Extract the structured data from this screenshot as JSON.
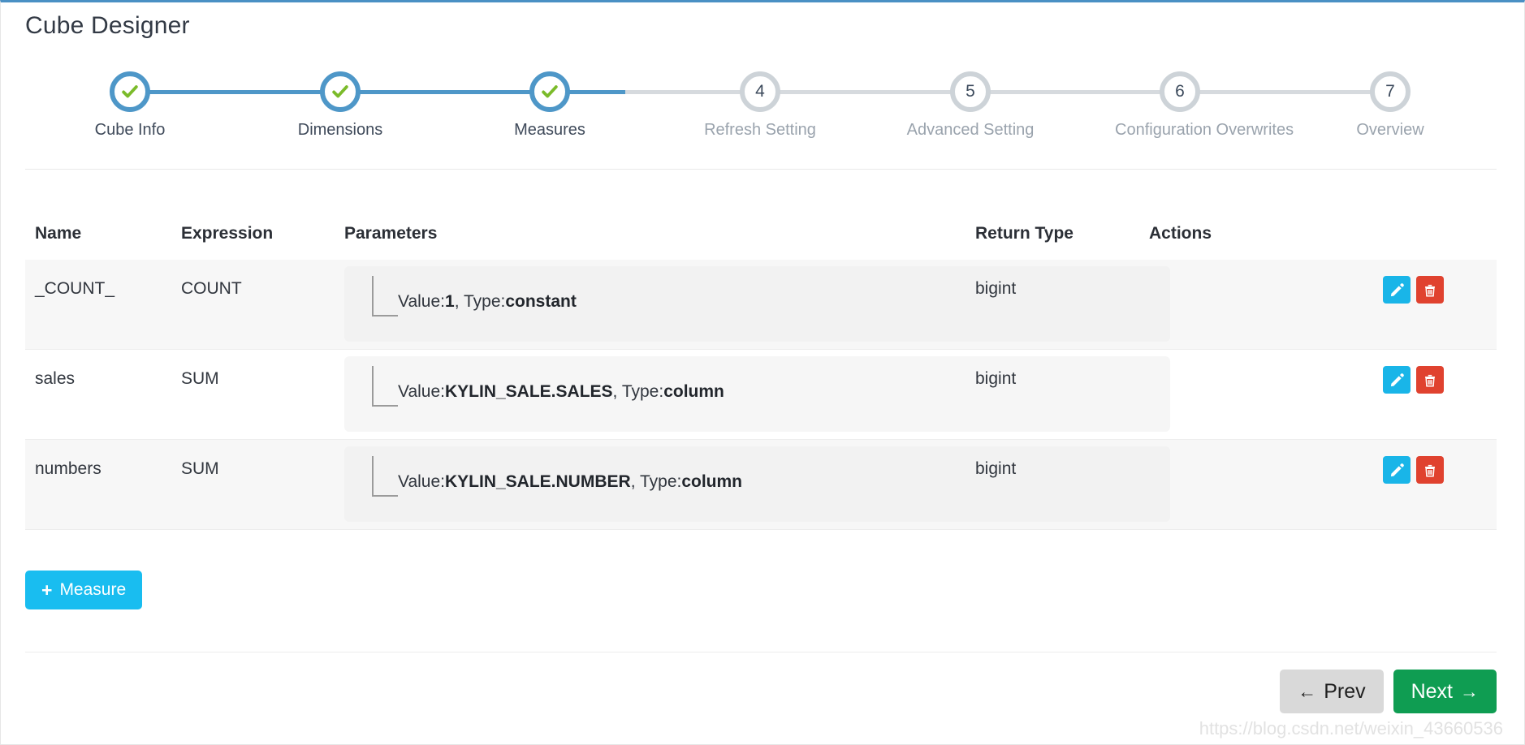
{
  "page": {
    "title": "Cube Designer",
    "accent_blue": "#4e97c8",
    "accent_green": "#0f9d52",
    "watermark": "https://blog.csdn.net/weixin_43660536"
  },
  "wizard": {
    "current_step": 3,
    "steps": [
      {
        "number": "1",
        "label": "Cube Info",
        "state": "done"
      },
      {
        "number": "2",
        "label": "Dimensions",
        "state": "done"
      },
      {
        "number": "3",
        "label": "Measures",
        "state": "done"
      },
      {
        "number": "4",
        "label": "Refresh Setting",
        "state": "todo"
      },
      {
        "number": "5",
        "label": "Advanced Setting",
        "state": "todo"
      },
      {
        "number": "6",
        "label": "Configuration Overwrites",
        "state": "todo"
      },
      {
        "number": "7",
        "label": "Overview",
        "state": "todo"
      }
    ]
  },
  "table": {
    "columns": {
      "name": "Name",
      "expression": "Expression",
      "parameters": "Parameters",
      "return_type": "Return Type",
      "actions": "Actions"
    },
    "rows": [
      {
        "name": "_COUNT_",
        "expression": "COUNT",
        "param_value_label": "Value:",
        "param_value": "1",
        "param_type_label": ", Type:",
        "param_type": "constant",
        "return_type": "bigint"
      },
      {
        "name": "sales",
        "expression": "SUM",
        "param_value_label": "Value:",
        "param_value": "KYLIN_SALE.SALES",
        "param_type_label": ", Type:",
        "param_type": "column",
        "return_type": "bigint"
      },
      {
        "name": "numbers",
        "expression": "SUM",
        "param_value_label": "Value:",
        "param_value": "KYLIN_SALE.NUMBER",
        "param_type_label": ", Type:",
        "param_type": "column",
        "return_type": "bigint"
      }
    ],
    "row_action_labels": {
      "edit": "Edit",
      "delete": "Delete"
    }
  },
  "add_measure": {
    "icon": "plus-icon",
    "label": "Measure"
  },
  "footer": {
    "prev_label": "Prev",
    "next_label": "Next",
    "prev_icon": "arrow-left-icon",
    "next_icon": "arrow-right-icon"
  }
}
